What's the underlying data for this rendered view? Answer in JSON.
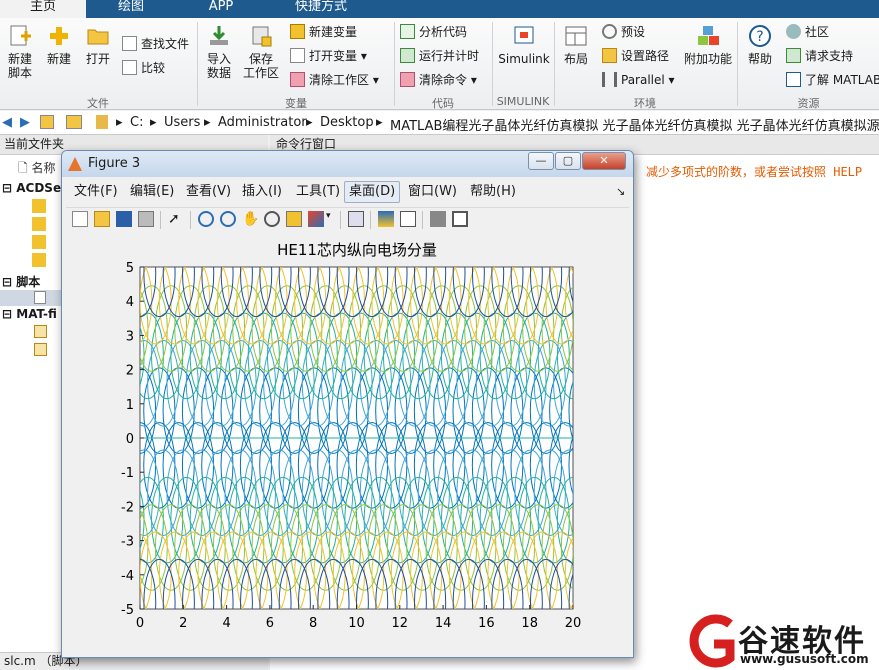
{
  "tabs": [
    "主页",
    "绘图",
    "APP",
    "快捷方式"
  ],
  "ribbon": {
    "file_group": {
      "label": "文件",
      "new_script": "新建\n脚本",
      "new": "新建",
      "open": "打开",
      "find_files": "查找文件",
      "compare": "比较"
    },
    "variable_group": {
      "label": "变量",
      "import": "导入\n数据",
      "save_ws": "保存\n工作区",
      "new_var": "新建变量",
      "open_var": "打开变量",
      "clear_ws": "清除工作区"
    },
    "code_group": {
      "label": "代码",
      "analyze": "分析代码",
      "run_time": "运行并计时",
      "clear_cmd": "清除命令"
    },
    "simulink_group": {
      "label": "SIMULINK",
      "simulink": "Simulink"
    },
    "env_group": {
      "label": "环境",
      "layout": "布局",
      "prefs": "预设",
      "set_path": "设置路径",
      "parallel": "Parallel",
      "addons": "附加功能"
    },
    "resources_group": {
      "label": "资源",
      "help": "帮助",
      "community": "社区",
      "support": "请求支持",
      "learn": "了解 MATLAB"
    }
  },
  "address": {
    "crumbs": [
      "C:",
      "Users",
      "Administrator",
      "Desktop",
      "MATLAB编程光子晶体光纤仿真模拟 光子晶体光纤仿真模拟 光子晶体光纤仿真模拟源码程序"
    ]
  },
  "left_panel": {
    "title": "当前文件夹",
    "col_name": "名称",
    "groups": [
      "ACDSee",
      "脚本",
      "MAT-fi"
    ],
    "status": "slc.m （脚本）"
  },
  "cmd_panel": {
    "title": "命令行窗口",
    "line": "减少多项式的阶数，或者尝试按照 HELP"
  },
  "figure": {
    "title": "Figure 3",
    "menus": [
      "文件(F)",
      "编辑(E)",
      "查看(V)",
      "插入(I)",
      "工具(T)",
      "桌面(D)",
      "窗口(W)",
      "帮助(H)"
    ]
  },
  "chart_data": {
    "type": "line",
    "title": "HE11芯内纵向电场分量",
    "xlabel": "",
    "ylabel": "",
    "xlim": [
      0,
      20
    ],
    "ylim": [
      -5,
      5
    ],
    "xticks": [
      "0",
      "2",
      "4",
      "6",
      "8",
      "10",
      "12",
      "14",
      "16",
      "18",
      "20"
    ],
    "yticks": [
      "-5",
      "-4",
      "-3",
      "-2",
      "-1",
      "0",
      "1",
      "2",
      "3",
      "4",
      "5"
    ],
    "series": [
      {
        "rx": 0.72,
        "cy": 0.8,
        "color": "#0072bd",
        "phase": 0
      },
      {
        "rx": 0.72,
        "cy": 1.6,
        "color": "#3fa6d9",
        "phase": 0.18
      },
      {
        "rx": 0.72,
        "cy": 2.4,
        "color": "#23b29a",
        "phase": 0.36
      },
      {
        "rx": 0.72,
        "cy": 3.2,
        "color": "#8cc63f",
        "phase": 0.54
      },
      {
        "rx": 0.72,
        "cy": 4.0,
        "color": "#f2c12e",
        "phase": 0.72
      },
      {
        "rx": 0.72,
        "cy": 4.8,
        "color": "#1f4e9c",
        "phase": 0.9
      }
    ]
  },
  "colors": {
    "tabbar": "#1e5a8e",
    "accent": "#e65c00",
    "brand_red": "#d6201f"
  },
  "watermark": {
    "name": "谷速软件",
    "url": "www.gususoft.com"
  }
}
